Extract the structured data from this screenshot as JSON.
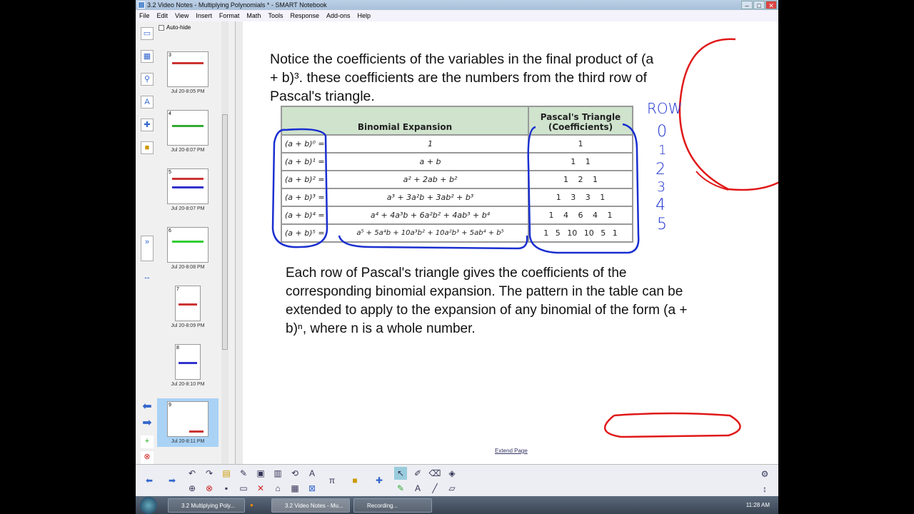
{
  "window": {
    "title": "3.2 Video Notes - Multiplying Polynomials * - SMART Notebook",
    "min": "–",
    "max": "□",
    "close": "✕"
  },
  "menu": [
    "File",
    "Edit",
    "View",
    "Insert",
    "Format",
    "Math",
    "Tools",
    "Response",
    "Add-ons",
    "Help"
  ],
  "sidebar": {
    "autohide": "Auto-hide",
    "pages": [
      {
        "num": "3",
        "label": "Jul 20-8:05 PM"
      },
      {
        "num": "4",
        "label": "Jul 20-8:07 PM"
      },
      {
        "num": "5",
        "label": "Jul 20-8:07 PM"
      },
      {
        "num": "6",
        "label": "Jul 20-8:08 PM"
      },
      {
        "num": "7",
        "label": "Jul 20-8:09 PM"
      },
      {
        "num": "8",
        "label": "Jul 20-8:10 PM"
      },
      {
        "num": "9",
        "label": "Jul 20-8:11 PM"
      }
    ]
  },
  "page": {
    "intro": "Notice the coefficients of the variables in the final product of (a + b)³. these coefficients are the numbers from the third row of Pascal's triangle.",
    "table": {
      "headers": [
        "Binomial Expansion",
        "Pascal's Triangle (Coefficients)"
      ],
      "rows": [
        {
          "lhs": "(a + b)⁰ =",
          "expansion": "1",
          "coeffs": "1"
        },
        {
          "lhs": "(a + b)¹ =",
          "expansion": "a + b",
          "coeffs": "1 1"
        },
        {
          "lhs": "(a + b)² =",
          "expansion": "a² + 2ab + b²",
          "coeffs": "1 2 1"
        },
        {
          "lhs": "(a + b)³ =",
          "expansion": "a³ + 3a²b + 3ab² + b³",
          "coeffs": "1 3 3 1"
        },
        {
          "lhs": "(a + b)⁴ =",
          "expansion": "a⁴ + 4a³b + 6a²b² + 4ab³ + b⁴",
          "coeffs": "1 4 6 4 1"
        },
        {
          "lhs": "(a + b)⁵ =",
          "expansion": "a⁵ + 5a⁴b + 10a³b² + 10a²b³ + 5ab⁴ + b⁵",
          "coeffs": "1 5 10 10 5 1"
        }
      ]
    },
    "outro": "Each row of Pascal's triangle gives the coefficients of the corresponding binomial expansion. The pattern in the table can be extended to apply to the expansion of any binomial of the form (a + b)ⁿ, where n is a whole number.",
    "handwriting": {
      "row": "ROW",
      "digits": [
        "0",
        "1",
        "2",
        "3",
        "4",
        "5"
      ]
    },
    "extend": "Extend Page"
  },
  "taskbar": {
    "items": [
      "3.2 Multiplying Poly...",
      "3.2 Video Notes - Mu...",
      "Recording..."
    ],
    "clock": "11:28 AM"
  },
  "colors": {
    "ink_blue": "#1a2fd0",
    "ink_red": "#e01818",
    "header_green": "#cfe3cd"
  }
}
